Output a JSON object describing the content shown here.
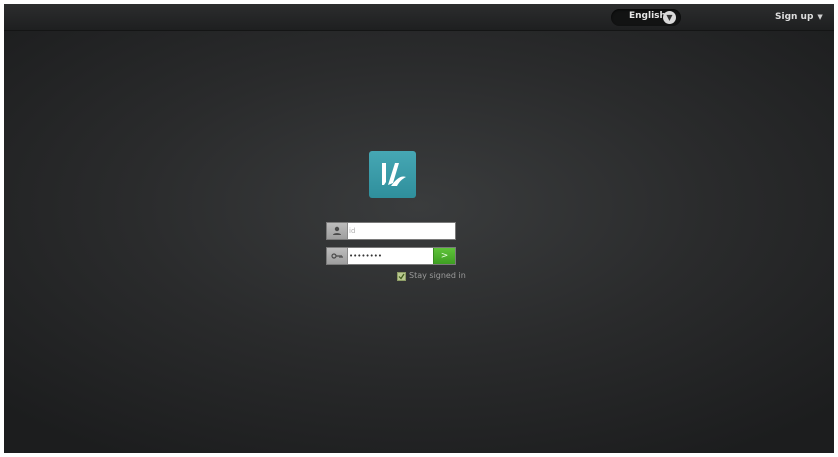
{
  "header": {
    "language": "English",
    "signup_label": "Sign up"
  },
  "icons": {
    "language_toggle": "chevron-down-icon",
    "signup_caret": "caret-down-icon",
    "user_field": "user-icon",
    "password_field": "key-icon",
    "submit": "arrow-right-icon",
    "checkbox": "check-icon"
  },
  "login": {
    "id_placeholder": "id",
    "password_value": "••••••••",
    "stay_signed_in_label": "Stay signed in",
    "stay_signed_in_checked": true
  },
  "colors": {
    "logo": "#3a9da9",
    "submit": "#4caf2c",
    "background": "#2a2b2c"
  }
}
